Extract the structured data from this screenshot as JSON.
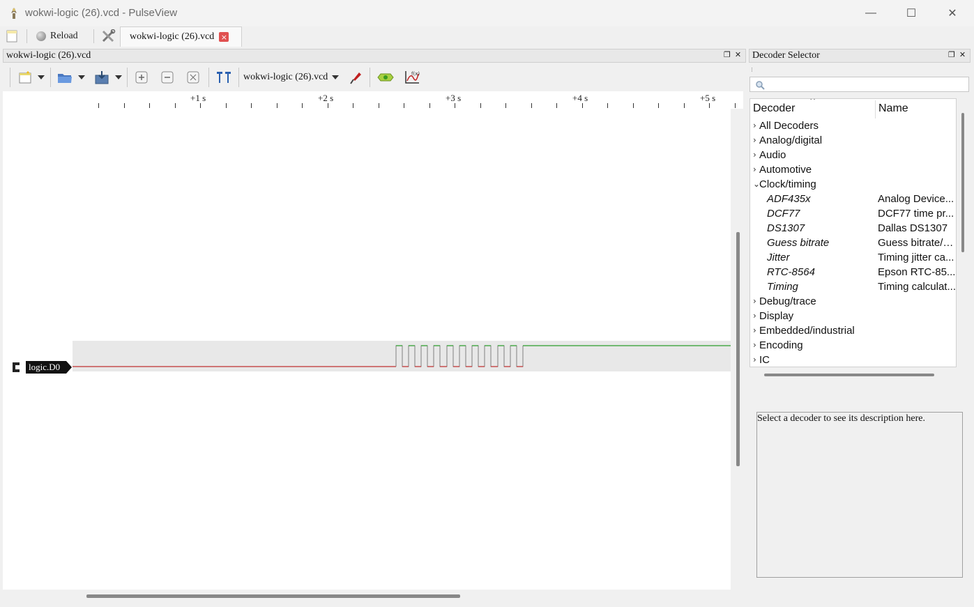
{
  "window": {
    "title": "wokwi-logic (26).vcd - PulseView",
    "minimize_glyph": "—",
    "maximize_glyph": "☐",
    "close_glyph": "✕"
  },
  "toolbar_main": {
    "reload_label": "Reload",
    "tab_label": "wokwi-logic (26).vcd",
    "tab_close_glyph": "×"
  },
  "view": {
    "dock_title": "wokwi-logic (26).vcd",
    "device_label": "wokwi-logic (26).vcd",
    "signal_name": "logic.D0"
  },
  "ruler": {
    "labels": [
      "+1 s",
      "+2 s",
      "+3 s",
      "+4 s",
      "+5 s"
    ]
  },
  "decoder_selector": {
    "dock_title": "Decoder Selector",
    "search_placeholder": "",
    "col_decoder": "Decoder",
    "col_name": "Name",
    "categories_top": [
      {
        "label": "All Decoders",
        "exp": "›"
      },
      {
        "label": "Analog/digital",
        "exp": "›"
      },
      {
        "label": "Audio",
        "exp": "›"
      },
      {
        "label": "Automotive",
        "exp": "›"
      },
      {
        "label": "Clock/timing",
        "exp": "⌄"
      }
    ],
    "decoders": [
      {
        "id": "ADF435x",
        "name": "Analog Device..."
      },
      {
        "id": "DCF77",
        "name": "DCF77 time pr..."
      },
      {
        "id": "DS1307",
        "name": "Dallas DS1307"
      },
      {
        "id": "Guess bitrate",
        "name": "Guess bitrate/b..."
      },
      {
        "id": "Jitter",
        "name": "Timing jitter ca..."
      },
      {
        "id": "RTC-8564",
        "name": "Epson RTC-85..."
      },
      {
        "id": "Timing",
        "name": "Timing calculat..."
      }
    ],
    "categories_bottom": [
      {
        "label": "Debug/trace",
        "exp": "›"
      },
      {
        "label": "Display",
        "exp": "›"
      },
      {
        "label": "Embedded/industrial",
        "exp": "›"
      },
      {
        "label": "Encoding",
        "exp": "›"
      },
      {
        "label": "IC",
        "exp": "›"
      }
    ],
    "description": "Select a decoder to see its description here."
  },
  "colors": {
    "signal_high": "#2a9d2a",
    "signal_low": "#c03030",
    "accent_red": "#d9534f"
  }
}
